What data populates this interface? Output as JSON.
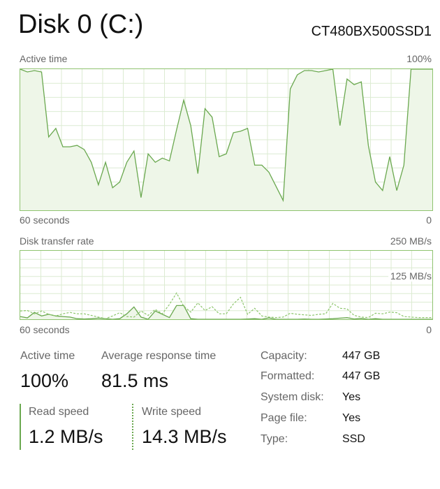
{
  "header": {
    "title": "Disk 0 (C:)",
    "model": "CT480BX500SSD1"
  },
  "active_graph": {
    "label": "Active time",
    "max_label": "100%",
    "time_label": "60 seconds",
    "min_label": "0",
    "values": [
      100,
      98,
      99,
      98,
      52,
      58,
      45,
      45,
      46,
      43,
      34,
      18,
      34,
      16,
      20,
      34,
      42,
      9,
      40,
      34,
      37,
      35,
      57,
      78,
      60,
      26,
      72,
      66,
      38,
      40,
      55,
      56,
      58,
      32,
      32,
      27,
      17,
      7,
      86,
      96,
      99,
      99,
      98,
      99,
      100,
      60,
      93,
      89,
      91,
      46,
      20,
      14,
      38,
      14,
      32,
      100,
      100,
      100,
      100
    ]
  },
  "transfer_graph": {
    "label": "Disk transfer rate",
    "max_label": "250 MB/s",
    "mid_label": "125 MB/s",
    "time_label": "60 seconds",
    "min_label": "0",
    "read_values": [
      10,
      5,
      25,
      12,
      18,
      12,
      10,
      8,
      2,
      1,
      2,
      4,
      2,
      0,
      2,
      20,
      45,
      8,
      0,
      30,
      18,
      6,
      50,
      50,
      2,
      0,
      0,
      0,
      0,
      0,
      0,
      0,
      1,
      2,
      0,
      5,
      0,
      0,
      0,
      0,
      1,
      0,
      0,
      1,
      2,
      4,
      6,
      1,
      3,
      0,
      2,
      0,
      0,
      0,
      0,
      0,
      0,
      0,
      0
    ],
    "write_values": [
      30,
      32,
      20,
      30,
      18,
      12,
      20,
      25,
      20,
      20,
      14,
      8,
      2,
      12,
      24,
      10,
      8,
      30,
      14,
      36,
      20,
      54,
      96,
      48,
      26,
      60,
      32,
      46,
      20,
      20,
      56,
      80,
      18,
      40,
      12,
      8,
      6,
      8,
      22,
      18,
      16,
      14,
      18,
      20,
      58,
      40,
      38,
      14,
      8,
      6,
      22,
      20,
      26,
      24,
      10,
      8,
      6,
      6,
      6
    ]
  },
  "stats": {
    "active_time_label": "Active time",
    "active_time_value": "100%",
    "avg_response_label": "Average response time",
    "avg_response_value": "81.5 ms",
    "read_label": "Read speed",
    "read_value": "1.2 MB/s",
    "write_label": "Write speed",
    "write_value": "14.3 MB/s"
  },
  "properties": [
    {
      "label": "Capacity:",
      "value": "447 GB"
    },
    {
      "label": "Formatted:",
      "value": "447 GB"
    },
    {
      "label": "System disk:",
      "value": "Yes"
    },
    {
      "label": "Page file:",
      "value": "Yes"
    },
    {
      "label": "Type:",
      "value": "SSD"
    }
  ],
  "colors": {
    "accent": "#6aa84f",
    "fill": "#eef6e8",
    "grid": "#dcebd2"
  }
}
